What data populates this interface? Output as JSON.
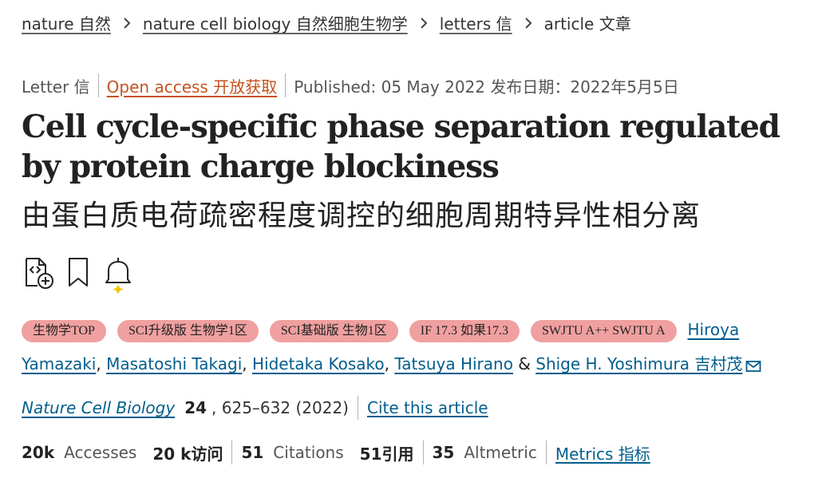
{
  "breadcrumb": {
    "items": [
      {
        "label": "nature 自然"
      },
      {
        "label": "nature cell biology 自然细胞生物学"
      },
      {
        "label": "letters 信"
      },
      {
        "label": "article 文章"
      }
    ]
  },
  "meta": {
    "type": "Letter 信",
    "open_access": "Open access 开放获取",
    "published": "Published: 05 May 2022 发布日期：2022年5月5日"
  },
  "title": {
    "en": "Cell cycle-specific phase separation regulated by protein charge blockiness",
    "cn": "由蛋白质电荷疏密程度调控的细胞周期特异性相分离"
  },
  "icons": [
    "code-download-icon",
    "bookmark-icon",
    "bell-alert-icon"
  ],
  "colors": {
    "link": "#025e8d",
    "open_access": "#c4541c",
    "badge": "#f0a0a0",
    "sparkle": "#f5c400"
  },
  "badges": [
    "生物学TOP",
    "SCI升级版 生物学1区",
    "SCI基础版 生物1区",
    "IF 17.3 如果17.3",
    "SWJTU A++ SWJTU A"
  ],
  "authors": {
    "a1": "Hiroya Yamazaki",
    "sep1": ", ",
    "a2": "Masatoshi Takagi",
    "sep2": ", ",
    "a3": "Hidetaka Kosako",
    "sep3": ", ",
    "a4": "Tatsuya Hirano",
    "amp": " & ",
    "a5": "Shige H. Yoshimura 吉村茂"
  },
  "citation": {
    "journal": "Nature Cell Biology",
    "volume": "24",
    "pages": ", 625–632 (2022)",
    "cite_link": "Cite this article"
  },
  "metrics": {
    "accesses_value": "20k",
    "accesses_label": "Accesses",
    "accesses_cn": "20 k访问",
    "citations_value": "51",
    "citations_label": "Citations",
    "citations_cn": "51引用",
    "altmetric_value": "35",
    "altmetric_label": "Altmetric",
    "metrics_link": "Metrics 指标"
  }
}
